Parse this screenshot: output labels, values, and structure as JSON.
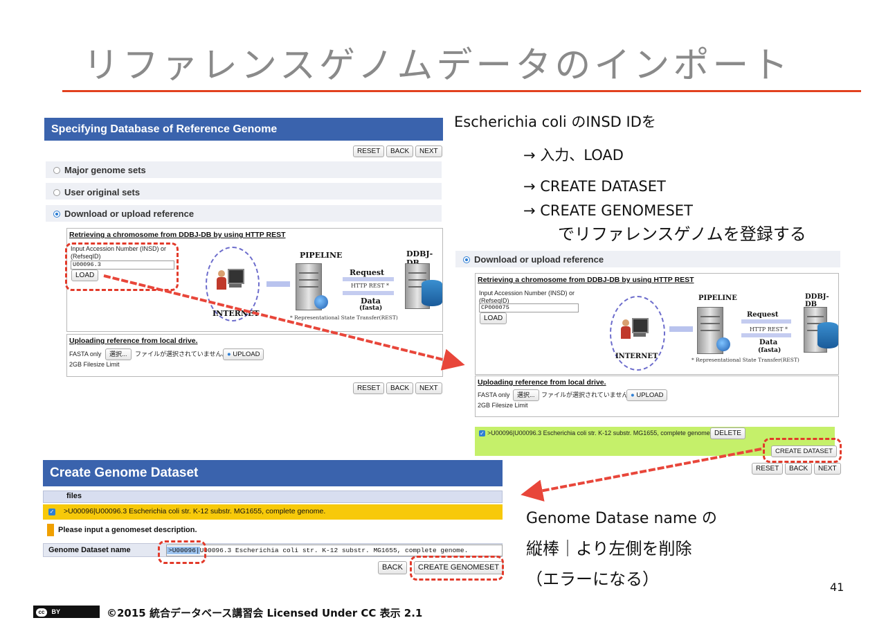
{
  "slide": {
    "title": "リファレンスゲノムデータのインポート",
    "page_number": "41",
    "footer": "©2015 統合データベース講習会 Licensed Under CC  表示 2.1",
    "cc_badge": "BY",
    "accent_color": "#e2411f",
    "header_color": "#3a63ad"
  },
  "notes": {
    "line1": "Escherichia coli のINSD IDを",
    "line2": "→ 入力、LOAD",
    "line3": "→ CREATE DATASET",
    "line4": "→ CREATE GENOMESET",
    "line5": "でリファレンスゲノムを登録する",
    "lower1": "Genome Datase name の",
    "lower2": "縦棒｜より左側を削除",
    "lower3": "（エラーになる）"
  },
  "shot1": {
    "header": "Specifying Database of Reference Genome",
    "buttons": {
      "reset": "RESET",
      "back": "BACK",
      "next": "NEXT"
    },
    "options": [
      "Major genome sets",
      "User original sets",
      "Download or upload reference"
    ],
    "retrieve_title": "Retrieving a chromosome from DDBJ-DB by using HTTP REST",
    "accession_label": "Input Accession Number (INSD) or (RefseqID)",
    "accession_value": "U00096.3",
    "load_button": "LOAD",
    "upload_title": "Uploading reference from local drive.",
    "fasta_only": "FASTA only",
    "choose_button": "選択...",
    "no_file": "ファイルが選択されていません。",
    "upload_button": "UPLOAD",
    "limit": "2GB Filesize Limit"
  },
  "diagram": {
    "pipeline": "PIPELINE",
    "ddbj": "DDBJ-DB",
    "request": "Request",
    "http_rest": "HTTP REST *",
    "data": "Data",
    "fasta": "(fasta)",
    "internet": "INTERNET",
    "footnote": "* Representational State Transfer(REST)"
  },
  "shot2": {
    "option": "Download or upload reference",
    "retrieve_title": "Retrieving a chromosome from DDBJ-DB by using HTTP REST",
    "accession_label": "Input Accession Number (INSD) or (RefseqID)",
    "accession_value": "CP000075",
    "load_button": "LOAD",
    "upload_title": "Uploading reference from local drive.",
    "fasta_only": "FASTA only",
    "choose_button": "選択...",
    "no_file": "ファイルが選択されていません。",
    "upload_button": "UPLOAD",
    "limit": "2GB Filesize Limit",
    "result_row": ">U00096|U00096.3 Escherichia coli str. K-12 substr. MG1655, complete genome.",
    "delete_button": "DELETE",
    "create_dataset_button": "CREATE DATASET",
    "buttons": {
      "reset": "RESET",
      "back": "BACK",
      "next": "NEXT"
    }
  },
  "shot3": {
    "header": "Create Genome Dataset",
    "files_col": "files",
    "file_row": ">U00096|U00096.3 Escherichia coli str. K-12 substr. MG1655, complete genome.",
    "warning": "Please input a genomeset description.",
    "name_label": "Genome Dataset name",
    "name_value_prefix": ">U00096|",
    "name_value_rest": "U00096.3 Escherichia coli str. K-12 substr. MG1655, complete genome.",
    "back_button": "BACK",
    "create_genomeset_button": "CREATE GENOMESET"
  }
}
